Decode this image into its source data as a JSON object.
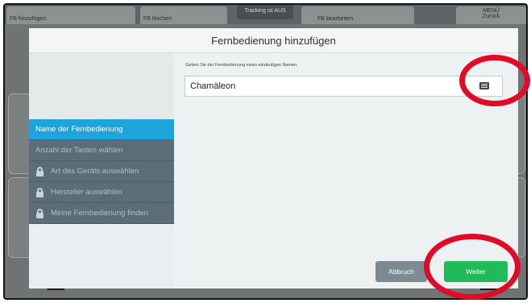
{
  "toolbar": {
    "add_label": "FB hinzufügen",
    "delete_label": "FB löschen",
    "edit_label": "FB bearbeiten",
    "menu_label": "MENÜ",
    "back_label": "Zurück",
    "tracking_status": "Tracking ist AUS"
  },
  "dialog": {
    "title": "Fernbedienung hinzufügen",
    "instruction": "Geben Sie der Fernbedienung einen eindeutigen Namen.",
    "name_value": "Chamäleon",
    "keyboard_icon": "keyboard-icon",
    "cancel_label": "Abbruch",
    "next_label": "Weiter"
  },
  "steps": [
    {
      "label": "Name der Fernbedienung",
      "state": "active"
    },
    {
      "label": "Anzahl der Tasten wählen",
      "state": "pending"
    },
    {
      "label": "Art des Geräts auswählen",
      "state": "locked"
    },
    {
      "label": "Hersteller auswählen",
      "state": "locked"
    },
    {
      "label": "Meine Fernbedienung finden",
      "state": "locked"
    }
  ],
  "colors": {
    "accent": "#1da5d9",
    "primary_button": "#21ba59",
    "secondary_button": "#7c8b91",
    "sidebar_step": "#5b6e77",
    "annotation": "#e00b29"
  }
}
